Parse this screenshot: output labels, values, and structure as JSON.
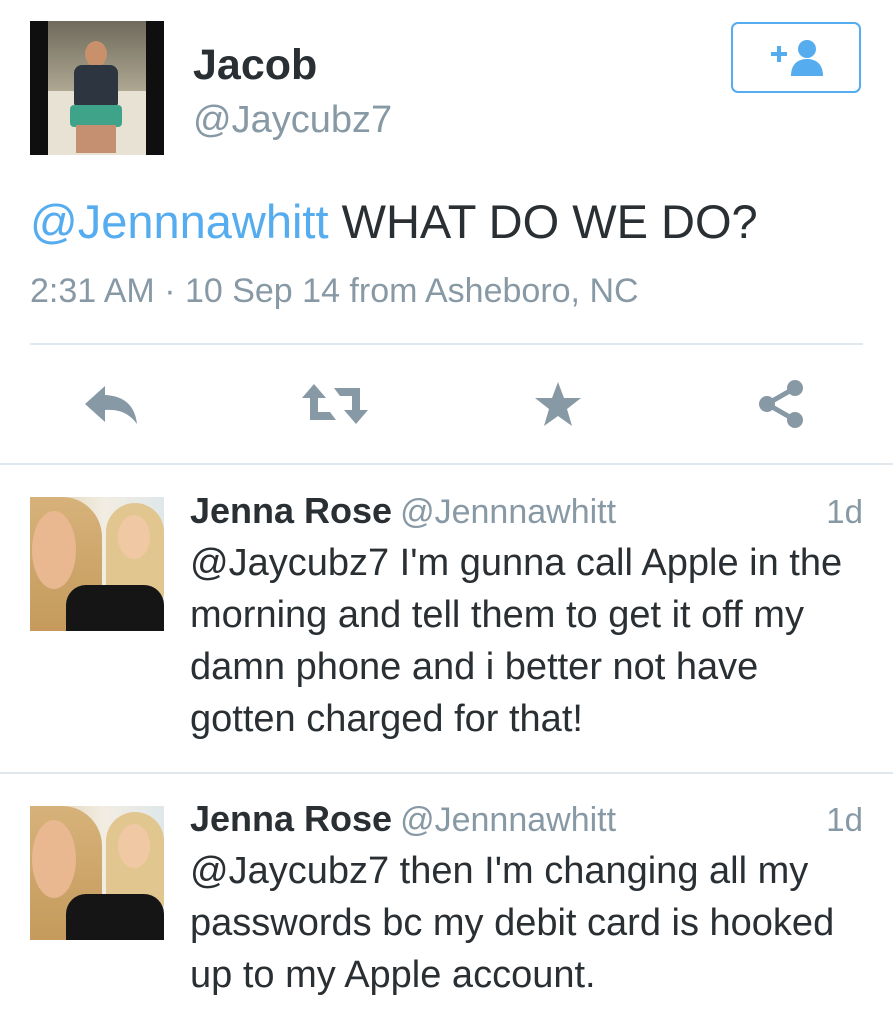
{
  "tweet": {
    "author_name": "Jacob",
    "author_handle": "@Jaycubz7",
    "mention": "@Jennnawhitt",
    "text": " WHAT DO WE DO?",
    "meta": "2:31 AM · 10 Sep 14 from Asheboro, NC"
  },
  "actions": {
    "reply_icon": "reply-arrow",
    "retweet_icon": "retweet-arrows",
    "favorite_icon": "star",
    "share_icon": "share-nodes",
    "follow_icon": "add-user"
  },
  "replies": [
    {
      "name": "Jenna Rose",
      "handle": "@Jennnawhitt",
      "time": "1d",
      "text": "@Jaycubz7 I'm gunna call Apple in the morning and tell them to get it off my damn phone and i better not have gotten charged for that!"
    },
    {
      "name": "Jenna Rose",
      "handle": "@Jennnawhitt",
      "time": "1d",
      "text": "@Jaycubz7 then I'm changing all my passwords bc my debit card is hooked up to my Apple account."
    }
  ],
  "colors": {
    "accent": "#55acee",
    "muted": "#8899a6",
    "text": "#292f33",
    "divider": "#e1e8ed"
  }
}
